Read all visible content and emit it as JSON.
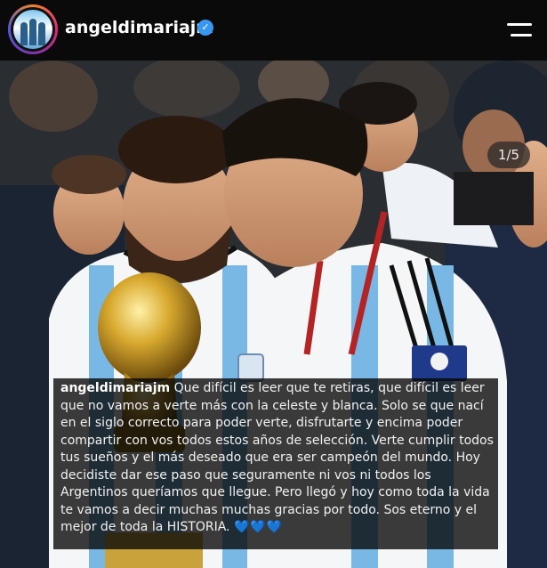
{
  "header": {
    "username": "angeldimariajm",
    "verified_glyph": "✓"
  },
  "photo": {
    "counter": "1/5"
  },
  "caption": {
    "username": "angeldimariajm",
    "text": "Que difícil es leer que te retiras, que difícil es leer que no vamos a verte más con la celeste y blanca. Solo se que nací en el siglo correcto para poder verte, disfrutarte y encima poder compartir con vos todos estos años de selección. Verte cumplir todos tus sueños y el más deseado que era ser campeón del mundo. Hoy decidiste dar ese paso que seguramente ni vos ni todos los Argentinos queríamos que llegue. Pero llegó y hoy como toda la vida te vamos a decir muchas muchas gracias por todo. Sos eterno y el mejor de toda la HISTORIA.",
    "emoji": "💙💙💙"
  },
  "icons": {
    "verified": "verified-badge-icon",
    "menu": "menu-icon"
  },
  "colors": {
    "verified_blue": "#3897f0",
    "heart_blue": "#2d7df6"
  }
}
